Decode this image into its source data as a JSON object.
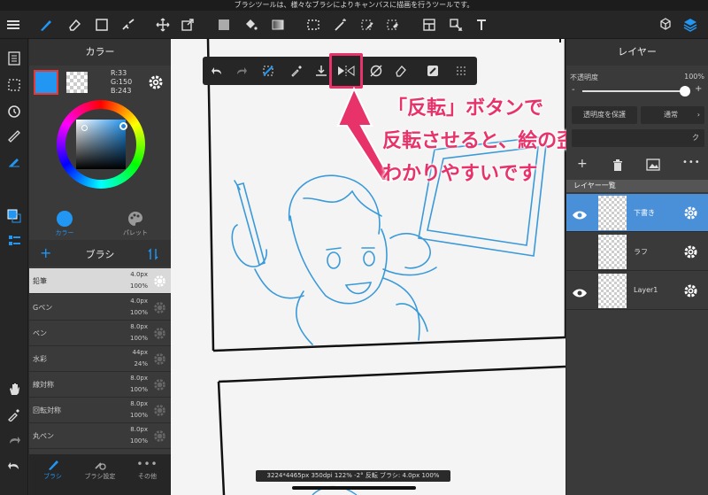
{
  "top_hint": "ブラシツールは、様々なブラシによりキャンバスに描画を行うツールです。",
  "color_panel": {
    "title": "カラー",
    "rgb": {
      "r": "R:33",
      "g": "G:150",
      "b": "B:243"
    },
    "tabs": [
      "カラー",
      "パレット"
    ],
    "accent": "#2196f3"
  },
  "brush_panel": {
    "title": "ブラシ",
    "brushes": [
      {
        "name": "鉛筆",
        "size": "4.0px",
        "opacity": "100%",
        "selected": true
      },
      {
        "name": "Gペン",
        "size": "4.0px",
        "opacity": "100%"
      },
      {
        "name": "ペン",
        "size": "8.0px",
        "opacity": "100%"
      },
      {
        "name": "水彩",
        "size": "44px",
        "opacity": "24%"
      },
      {
        "name": "線対称",
        "size": "8.0px",
        "opacity": "100%"
      },
      {
        "name": "回転対称",
        "size": "8.0px",
        "opacity": "100%"
      },
      {
        "name": "丸ペン",
        "size": "8.0px",
        "opacity": "100%"
      }
    ],
    "bottom_tabs": [
      "ブラシ",
      "ブラシ設定",
      "その他"
    ]
  },
  "layer_panel": {
    "title": "レイヤー",
    "opacity_label": "不透明度",
    "opacity_value": "100%",
    "opacity_fraction": 1.0,
    "protect_label": "透明度を保護",
    "blend_label": "通常",
    "clip_label": "ク",
    "list_label": "レイヤー一覧",
    "layers": [
      {
        "name": "下書き",
        "visible": true,
        "selected": true
      },
      {
        "name": "ラフ",
        "visible": false,
        "selected": false
      },
      {
        "name": "Layer1",
        "visible": true,
        "selected": false
      }
    ]
  },
  "status_bar": "3224*4465px 350dpi 122% -2° 反転 ブラシ: 4.0px 100%",
  "annotation": {
    "line1": "「反転」ボタンで",
    "line2": "反転させると、絵の歪みが",
    "line3": "わかりやすいです"
  },
  "colors": {
    "highlight": "#e8326a",
    "accent": "#2196f3"
  }
}
